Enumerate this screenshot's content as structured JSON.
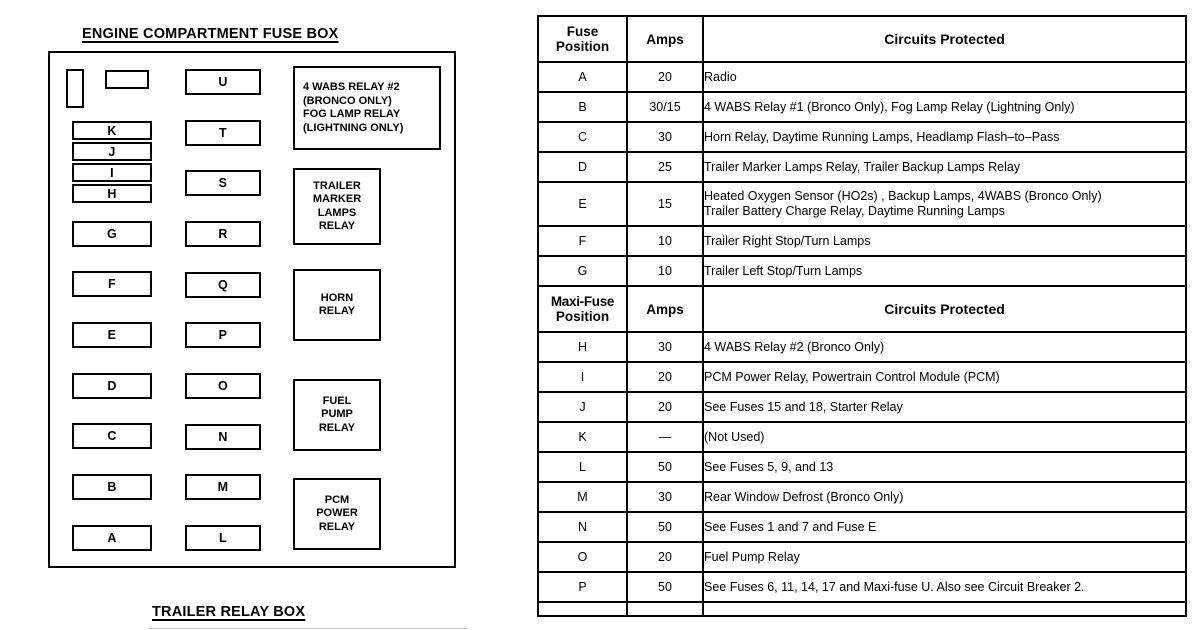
{
  "document": {
    "background_color": "#ffffff",
    "ink_color": "#000000"
  },
  "diagram": {
    "title": "ENGINE COMPARTMENT FUSE BOX",
    "footer_title": "TRAILER RELAY BOX",
    "blank_slots": [
      {
        "name": "blank-vertical-slot",
        "label": ""
      },
      {
        "name": "blank-horizontal-slot",
        "label": ""
      }
    ],
    "column_left": [
      {
        "label": "K"
      },
      {
        "label": "J"
      },
      {
        "label": "I"
      },
      {
        "label": "H"
      },
      {
        "label": "G"
      },
      {
        "label": "F"
      },
      {
        "label": "E"
      },
      {
        "label": "D"
      },
      {
        "label": "C"
      },
      {
        "label": "B"
      },
      {
        "label": "A"
      }
    ],
    "column_middle": [
      {
        "label": "U"
      },
      {
        "label": "T"
      },
      {
        "label": "S"
      },
      {
        "label": "R"
      },
      {
        "label": "Q"
      },
      {
        "label": "P"
      },
      {
        "label": "O"
      },
      {
        "label": "N"
      },
      {
        "label": "M"
      },
      {
        "label": "L"
      }
    ],
    "relays": [
      {
        "name": "wabs-fog-lamp-relay",
        "lines": [
          "4 WABS RELAY  #2",
          "(BRONCO ONLY)",
          "FOG LAMP RELAY",
          "(LIGHTNING ONLY)"
        ]
      },
      {
        "name": "trailer-marker-lamps-relay",
        "lines": [
          "TRAILER",
          "MARKER",
          "LAMPS",
          "RELAY"
        ]
      },
      {
        "name": "horn-relay",
        "lines": [
          "HORN",
          "RELAY"
        ]
      },
      {
        "name": "fuel-pump-relay",
        "lines": [
          "FUEL",
          "PUMP",
          "RELAY"
        ]
      },
      {
        "name": "pcm-power-relay",
        "lines": [
          "PCM",
          "POWER",
          "RELAY"
        ]
      }
    ]
  },
  "table": {
    "fuse_header": {
      "position": "Fuse Position",
      "position_line1": "Fuse",
      "position_line2": "Position",
      "amps": "Amps",
      "circuits": "Circuits Protected"
    },
    "maxifuse_header": {
      "position_line1": "Maxi-Fuse",
      "position_line2": "Position",
      "amps": "Amps",
      "circuits": "Circuits Protected"
    },
    "fuse_rows": [
      {
        "position": "A",
        "amps": "20",
        "circuits": "Radio"
      },
      {
        "position": "B",
        "amps": "30/15",
        "circuits": "4 WABS Relay #1 (Bronco Only), Fog Lamp Relay (Lightning Only)"
      },
      {
        "position": "C",
        "amps": "30",
        "circuits": "Horn Relay, Daytime Running Lamps, Headlamp Flash–to–Pass"
      },
      {
        "position": "D",
        "amps": "25",
        "circuits": "Trailer Marker Lamps Relay, Trailer Backup Lamps Relay"
      },
      {
        "position": "E",
        "amps": "15",
        "circuits": "Heated Oxygen Sensor (HO2s) , Backup Lamps, 4WABS (Bronco Only)",
        "circuits_line2": "Trailer Battery Charge Relay, Daytime Running Lamps",
        "tall": true
      },
      {
        "position": "F",
        "amps": "10",
        "circuits": "Trailer Right Stop/Turn Lamps"
      },
      {
        "position": "G",
        "amps": "10",
        "circuits": "Trailer Left Stop/Turn Lamps"
      }
    ],
    "maxifuse_rows": [
      {
        "position": "H",
        "amps": "30",
        "circuits": "4 WABS Relay #2 (Bronco Only)"
      },
      {
        "position": "I",
        "amps": "20",
        "circuits": "PCM Power Relay, Powertrain Control Module (PCM)"
      },
      {
        "position": "J",
        "amps": "20",
        "circuits": "See Fuses 15 and 18, Starter Relay"
      },
      {
        "position": "K",
        "amps": "—",
        "circuits": "(Not Used)"
      },
      {
        "position": "L",
        "amps": "50",
        "circuits": "See Fuses 5, 9, and 13"
      },
      {
        "position": "M",
        "amps": "30",
        "circuits": "Rear Window Defrost (Bronco Only)"
      },
      {
        "position": "N",
        "amps": "50",
        "circuits": "See Fuses 1 and 7 and Fuse E"
      },
      {
        "position": "O",
        "amps": "20",
        "circuits": "Fuel Pump Relay"
      },
      {
        "position": "P",
        "amps": "50",
        "circuits": "See Fuses 6, 11, 14, 17 and Maxi-fuse U. Also see Circuit Breaker 2."
      },
      {
        "position": "",
        "amps": "",
        "circuits": "",
        "clipped": true
      }
    ]
  }
}
